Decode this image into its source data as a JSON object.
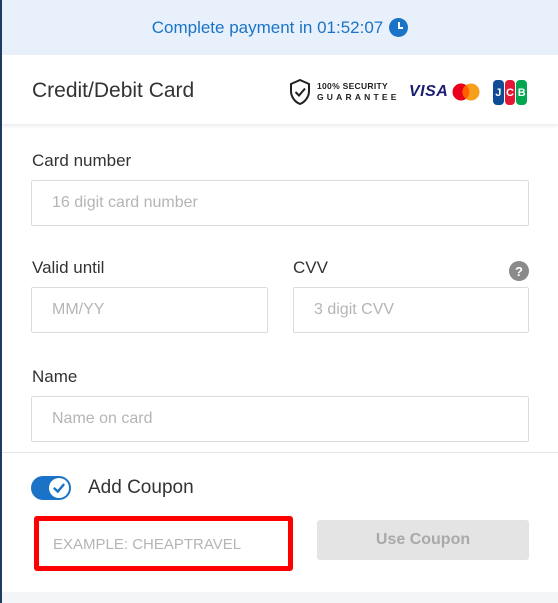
{
  "timer": {
    "text": "Complete payment in 01:52:07",
    "accent": "#1a73c7"
  },
  "card": {
    "title": "Credit/Debit Card",
    "security_line1": "100% SECURITY",
    "security_line2": "GUARANTEE",
    "brands": {
      "visa": "VISA",
      "jcb": [
        "J",
        "C",
        "B"
      ]
    }
  },
  "form": {
    "card_number": {
      "label": "Card number",
      "placeholder": "16 digit card number",
      "value": ""
    },
    "valid_until": {
      "label": "Valid until",
      "placeholder": "MM/YY",
      "value": ""
    },
    "cvv": {
      "label": "CVV",
      "placeholder": "3 digit CVV",
      "value": "",
      "help": "?"
    },
    "name": {
      "label": "Name",
      "placeholder": "Name on card",
      "value": ""
    }
  },
  "coupon": {
    "toggle_label": "Add Coupon",
    "toggle_on": true,
    "placeholder": "EXAMPLE: CHEAPTRAVEL",
    "value": "",
    "button_label": "Use Coupon",
    "highlight_color": "#ff0000"
  },
  "icons": {
    "timer": "clock-icon",
    "security": "shield-check-icon",
    "cvv_help": "question-icon",
    "toggle": "check-icon"
  }
}
